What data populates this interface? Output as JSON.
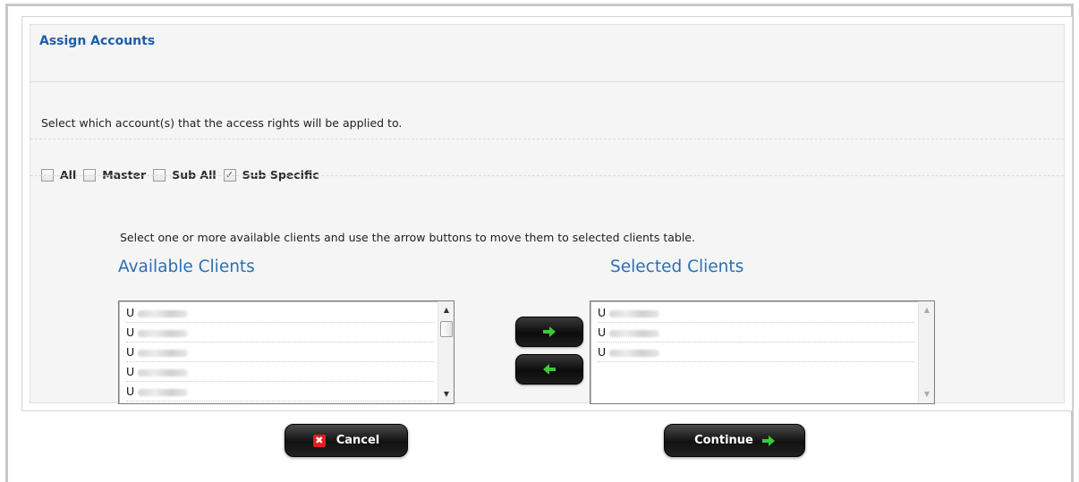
{
  "section": {
    "title": "Assign Accounts",
    "instruction": "Select which account(s) that the access rights will be applied to."
  },
  "account_options": [
    {
      "label": "All",
      "checked": false
    },
    {
      "label": "Master",
      "checked": false
    },
    {
      "label": "Sub All",
      "checked": false
    },
    {
      "label": "Sub Specific",
      "checked": true
    }
  ],
  "move_hint": "Select one or more available clients and use the arrow buttons to move them to selected clients table.",
  "available_clients": {
    "title": "Available Clients",
    "items": [
      "U",
      "U",
      "U",
      "U",
      "U"
    ]
  },
  "selected_clients": {
    "title": "Selected Clients",
    "items": [
      "U",
      "U",
      "U"
    ]
  },
  "buttons": {
    "move_right_icon": "green-right-arrow-icon",
    "move_left_icon": "green-left-arrow-icon",
    "cancel_label": "Cancel",
    "cancel_icon": "red-x-icon",
    "continue_label": "Continue",
    "continue_icon": "green-right-arrow-icon"
  },
  "colors": {
    "title_blue": "#1a5fa8",
    "list_title_blue": "#2a6fb5",
    "button_black": "#111111",
    "arrow_green": "#3cc93c",
    "cancel_red": "#e0201c"
  }
}
